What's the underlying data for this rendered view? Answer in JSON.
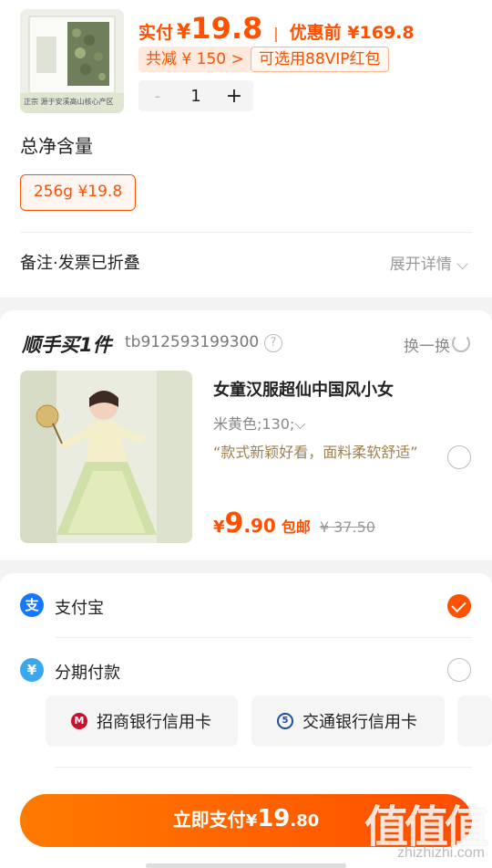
{
  "product": {
    "thumb_caption": "正宗 源于安溪高山核心产区",
    "price": {
      "pay_label": "实付",
      "currency": "¥",
      "pay_amount": "19.8",
      "separator": "|",
      "original_label": "优惠前 ¥169.8"
    },
    "tags": {
      "discount": "共减 ¥ 150 >",
      "vip": "可选用88VIP红包"
    },
    "stepper": {
      "minus": "-",
      "quantity": "1",
      "plus": "+"
    },
    "spec": {
      "title": "总净含量",
      "selected_option": "256g ¥19.8"
    },
    "note": {
      "label": "备注·发票已折叠",
      "expand": "展开详情 ⌵"
    }
  },
  "upsell": {
    "title": "顺手买1件",
    "user": "tb912593199300",
    "help": "?",
    "swap": "换一换",
    "item": {
      "title": "女童汉服超仙中国风小女",
      "sku": "米黄色;130;⌵",
      "review": "“款式新颖好看，面料柔软舒适”",
      "price_currency": "¥",
      "price_int": "9",
      "price_dec": ".90",
      "shipping": "包邮",
      "original_price": "¥ 37.50"
    }
  },
  "payment": {
    "alipay": {
      "icon": "支",
      "name": "支付宝"
    },
    "installment": {
      "icon": "¥",
      "name": "分期付款"
    },
    "banks": [
      {
        "icon": "M",
        "name": "招商银行信用卡"
      },
      {
        "icon": "5",
        "name": "交通银行信用卡"
      }
    ],
    "pay_button": {
      "label": "立即支付",
      "currency": "¥",
      "amount_int": "19",
      "amount_dec": ".80"
    }
  },
  "watermark": {
    "big": "值值值",
    "small": "zhizhizhi.com"
  },
  "colors": {
    "accent": "#ff5000",
    "alipay_blue": "#1677ff",
    "cmb_red": "#c8102e",
    "bocom_blue": "#1f4ea1"
  }
}
